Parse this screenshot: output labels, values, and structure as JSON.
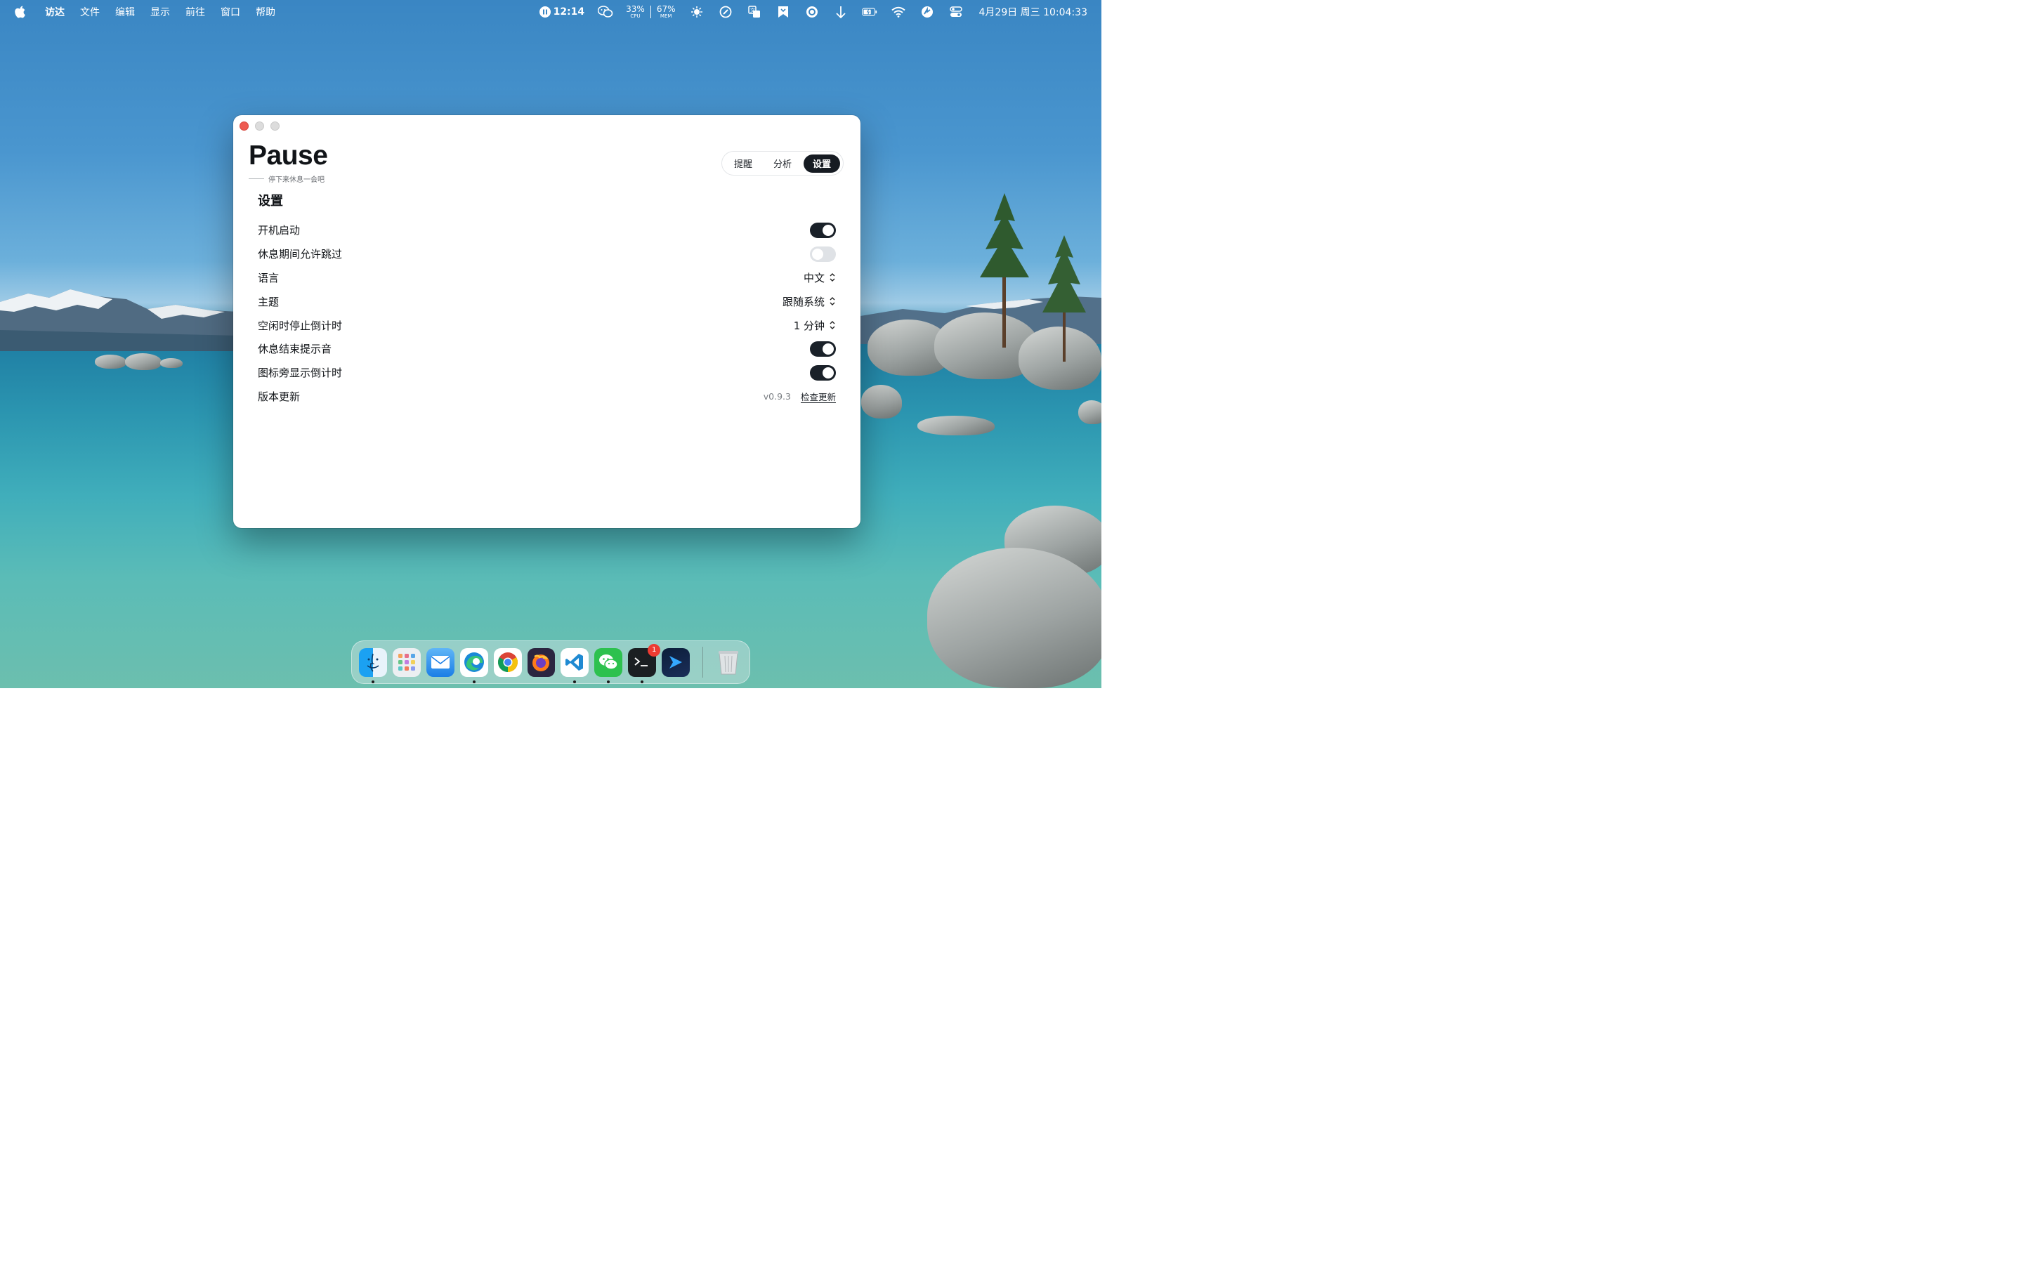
{
  "menubar": {
    "apple_icon": "apple-icon",
    "items": [
      "访达",
      "文件",
      "编辑",
      "显示",
      "前往",
      "窗口",
      "帮助"
    ],
    "timer": "12:14",
    "cpu": {
      "value": "33%",
      "label": "CPU"
    },
    "mem": {
      "value": "67%",
      "label": "MEM"
    },
    "datetime": "4月29日 周三  10:04:33"
  },
  "window": {
    "app_name": "Pause",
    "tagline": "停下来休息一会吧",
    "tabs": [
      {
        "label": "提醒",
        "active": false
      },
      {
        "label": "分析",
        "active": false
      },
      {
        "label": "设置",
        "active": true
      }
    ],
    "settings": {
      "title": "设置",
      "launch_at_login": {
        "label": "开机启动",
        "value": true
      },
      "allow_skip": {
        "label": "休息期间允许跳过",
        "value": false
      },
      "language": {
        "label": "语言",
        "value": "中文"
      },
      "theme": {
        "label": "主题",
        "value": "跟随系统"
      },
      "idle_stop": {
        "label": "空闲时停止倒计时",
        "value": "1 分钟"
      },
      "end_sound": {
        "label": "休息结束提示音",
        "value": true
      },
      "icon_countdown": {
        "label": "图标旁显示倒计时",
        "value": true
      },
      "update": {
        "label": "版本更新",
        "version": "v0.9.3",
        "check_label": "检查更新"
      }
    }
  },
  "dock": {
    "apps": [
      "finder",
      "launchpad",
      "mail",
      "edge",
      "chrome",
      "firefox",
      "vscode",
      "wechat",
      "terminal",
      "prompt",
      "trash"
    ],
    "terminal_badge": "1"
  },
  "colors": {
    "accent_dark": "#161b22",
    "close_button": "#ee5b52"
  }
}
